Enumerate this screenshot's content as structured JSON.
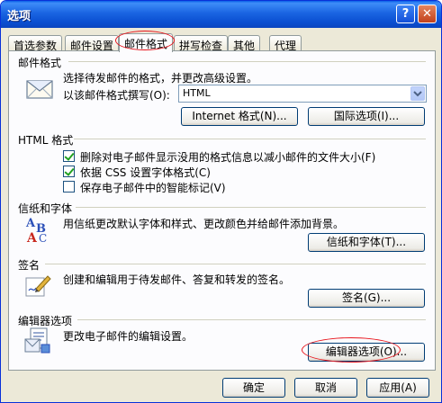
{
  "window": {
    "title": "选项",
    "help_label": "?",
    "close_label": "✕"
  },
  "tabs": [
    {
      "label": "首选参数"
    },
    {
      "label": "邮件设置"
    },
    {
      "label": "邮件格式"
    },
    {
      "label": "拼写检查"
    },
    {
      "label": "其他"
    },
    {
      "label": "代理"
    }
  ],
  "active_tab": "邮件格式",
  "mail_format": {
    "section_label": "邮件格式",
    "description": "选择待发邮件的格式，并更改高级设置。",
    "compose_label": "以该邮件格式撰写(O):",
    "compose_value": "HTML",
    "internet_format_button": "Internet 格式(N)...",
    "international_options_button": "国际选项(I)..."
  },
  "html_format": {
    "section_label": "HTML 格式",
    "options": [
      {
        "label": "删除对电子邮件显示没用的格式信息以减小邮件的文件大小(F)",
        "checked": true
      },
      {
        "label": "依据 CSS 设置字体格式(C)",
        "checked": true
      },
      {
        "label": "保存电子邮件中的智能标记(V)",
        "checked": false
      }
    ]
  },
  "stationery": {
    "section_label": "信纸和字体",
    "description": "用信纸更改默认字体和样式、更改颜色并给邮件添加背景。",
    "button": "信纸和字体(T)..."
  },
  "signature": {
    "section_label": "签名",
    "description": "创建和编辑用于待发邮件、答复和转发的签名。",
    "button": "签名(G)..."
  },
  "editor": {
    "section_label": "编辑器选项",
    "description": "更改电子邮件的编辑设置。",
    "button": "编辑器选项(O)..."
  },
  "footer": {
    "ok": "确定",
    "cancel": "取消",
    "apply": "应用(A)"
  },
  "colors": {
    "title_bar": "#0a4ed0",
    "dialog_bg": "#ece9d8",
    "annotation": "#e8141c"
  }
}
